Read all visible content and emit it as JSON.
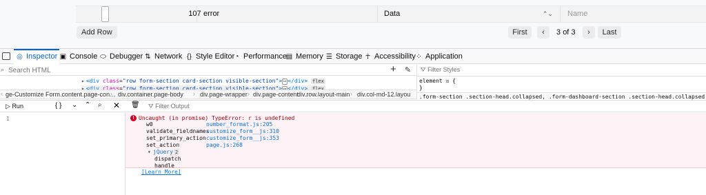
{
  "table": {
    "row": {
      "idx": "107",
      "fieldname": "error",
      "fieldtype": "Data",
      "label_placeholder": "Name"
    },
    "add_row_label": "Add Row",
    "pager": {
      "first": "First",
      "prev": "‹",
      "current": "3",
      "of": "of",
      "total": "3",
      "next": "›",
      "last": "Last"
    }
  },
  "devtools": {
    "tabs": [
      "Inspector",
      "Console",
      "Debugger",
      "Network",
      "Style Editor",
      "Performance",
      "Memory",
      "Storage",
      "Accessibility",
      "Application"
    ],
    "tab_icons": [
      "inspector-icon",
      "console-icon",
      "debugger-icon",
      "network-icon",
      "style-editor-icon",
      "performance-icon",
      "memory-icon",
      "storage-icon",
      "accessibility-icon",
      "application-icon"
    ],
    "active_tab": "Inspector",
    "search_html_placeholder": "Search HTML",
    "filter_styles_placeholder": "Filter Styles",
    "markup": {
      "tag_open": "<div",
      "attr": "class",
      "value": "\"row form-section card-section visible-section\"",
      "after": ">",
      "dots": "⋯",
      "close": "</div>",
      "badge": "flex"
    },
    "breadcrumbs": [
      "ge-Customize Form.content.page-con…",
      "div.container.page-body",
      "div.page-wrapper",
      "div.page-content",
      "div.row.layout-main",
      "div.col-md-12.layou"
    ],
    "rules": {
      "element": "element ⦂⦂ {",
      "close": "}",
      "selector": ".form-section .section-head.collapsed, .form-dashboard-section .section-head.collapsed ⦂⦂ {"
    },
    "console": {
      "run_label": "Run",
      "brace_label": "{ }",
      "filter_output_placeholder": "Filter Output",
      "line_number": "1",
      "error": {
        "message": "Uncaught (in promise) TypeError: r is undefined",
        "frames": [
          {
            "fn": "w0",
            "loc": "number_format.js:205"
          },
          {
            "fn": "validate_fieldnames",
            "loc": "customize_form__js:310"
          },
          {
            "fn": "set_primary_action",
            "loc": "customize_form__js:353"
          },
          {
            "fn": "set_action",
            "loc": "page.js:268"
          }
        ],
        "jquery_group": "jQuery",
        "jquery_count": "2",
        "jquery_frames": [
          "dispatch",
          "handle"
        ],
        "learn_more": "[Learn More]"
      }
    }
  }
}
